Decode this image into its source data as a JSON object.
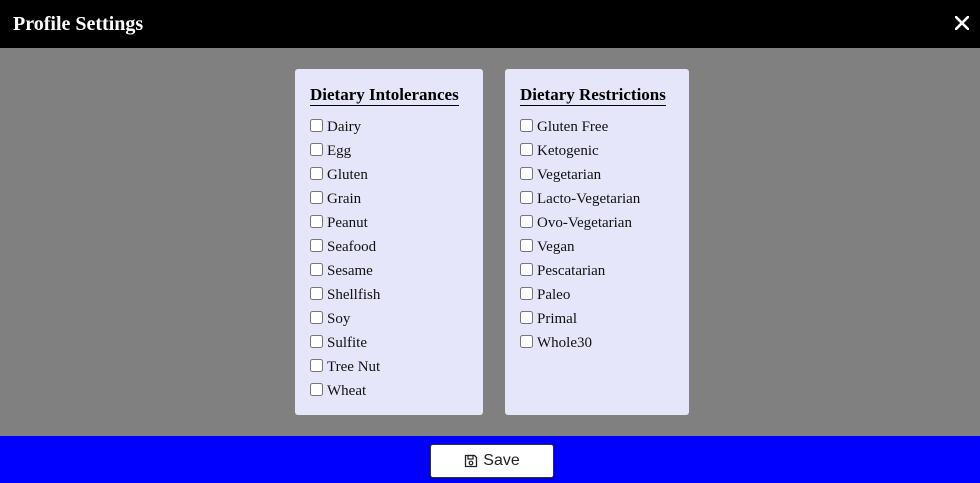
{
  "header": {
    "title": "Profile Settings",
    "close_icon": "close-icon",
    "background": "#000000"
  },
  "intolerances": {
    "title": "Dietary Intolerances",
    "options": [
      {
        "label": "Dairy",
        "checked": false
      },
      {
        "label": "Egg",
        "checked": false
      },
      {
        "label": "Gluten",
        "checked": false
      },
      {
        "label": "Grain",
        "checked": false
      },
      {
        "label": "Peanut",
        "checked": false
      },
      {
        "label": "Seafood",
        "checked": false
      },
      {
        "label": "Sesame",
        "checked": false
      },
      {
        "label": "Shellfish",
        "checked": false
      },
      {
        "label": "Soy",
        "checked": false
      },
      {
        "label": "Sulfite",
        "checked": false
      },
      {
        "label": "Tree Nut",
        "checked": false
      },
      {
        "label": "Wheat",
        "checked": false
      }
    ]
  },
  "restrictions": {
    "title": "Dietary Restrictions",
    "options": [
      {
        "label": "Gluten Free",
        "checked": false
      },
      {
        "label": "Ketogenic",
        "checked": false
      },
      {
        "label": "Vegetarian",
        "checked": false
      },
      {
        "label": "Lacto-Vegetarian",
        "checked": false
      },
      {
        "label": "Ovo-Vegetarian",
        "checked": false
      },
      {
        "label": "Vegan",
        "checked": false
      },
      {
        "label": "Pescatarian",
        "checked": false
      },
      {
        "label": "Paleo",
        "checked": false
      },
      {
        "label": "Primal",
        "checked": false
      },
      {
        "label": "Whole30",
        "checked": false
      }
    ]
  },
  "footer": {
    "save_label": "Save",
    "save_icon": "floppy-disk-icon",
    "background": "#0000ff"
  },
  "colors": {
    "page_background": "#808080",
    "card_background": "#e6e6fa"
  }
}
